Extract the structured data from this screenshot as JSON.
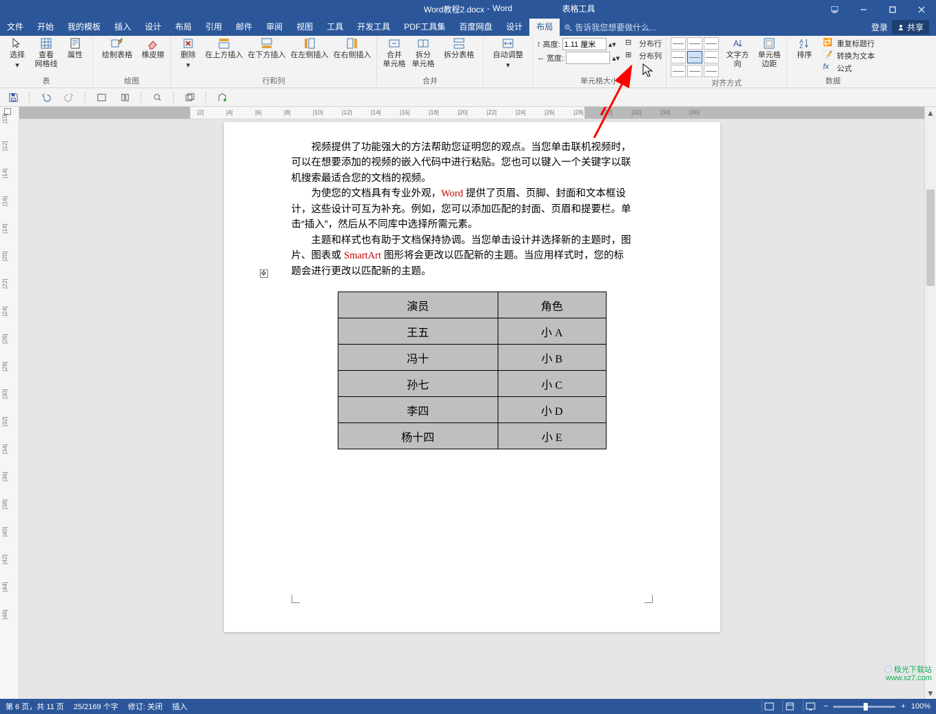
{
  "title": {
    "doc": "Word教程2.docx",
    "app": "Word",
    "tool_context": "表格工具"
  },
  "win": {
    "login": "登录",
    "share": "共享"
  },
  "tabs": [
    "文件",
    "开始",
    "我的模板",
    "插入",
    "设计",
    "布局",
    "引用",
    "邮件",
    "审阅",
    "视图",
    "工具",
    "开发工具",
    "PDF工具集",
    "百度网盘",
    "设计",
    "布局"
  ],
  "active_tab_index": 15,
  "tell_me": "告诉我您想要做什么...",
  "ribbon": {
    "g_table": {
      "select": "选择",
      "view_grid": "查看\n网格线",
      "props": "属性",
      "label": "表"
    },
    "g_draw": {
      "draw": "绘制表格",
      "erase": "橡皮擦",
      "label": "绘图"
    },
    "g_rc": {
      "delete": "删除",
      "ins_above": "在上方插入",
      "ins_below": "在下方插入",
      "ins_left": "在左侧插入",
      "ins_right": "在右侧插入",
      "label": "行和列"
    },
    "g_merge": {
      "merge": "合并\n单元格",
      "split": "拆分\n单元格",
      "split_tbl": "拆分表格",
      "label": "合并"
    },
    "g_auto": {
      "autofit": "自动调整",
      "label": ""
    },
    "g_size": {
      "height": "高度:",
      "width": "宽度:",
      "height_val": "1.11 厘米",
      "width_val": "",
      "dist_row": "分布行",
      "dist_col": "分布列",
      "label": "单元格大小"
    },
    "g_align": {
      "textdir": "文字方向",
      "margins": "单元格\n边距",
      "label": "对齐方式"
    },
    "g_data": {
      "sort": "排序",
      "repeat": "重复标题行",
      "convert": "转换为文本",
      "formula": "公式",
      "fx": "fx",
      "label": "数据"
    }
  },
  "ruler_h": [
    "|2|",
    "|4|",
    "|6|",
    "|8|",
    "|10|",
    "|12|",
    "|14|",
    "|16|",
    "|18|",
    "|20|",
    "|22|",
    "|24|",
    "|26|",
    "|28|",
    "|30|",
    "|32|",
    "|34|",
    "|36|"
  ],
  "ruler_v": [
    "|10|",
    "|12|",
    "|14|",
    "|16|",
    "|18|",
    "|20|",
    "|22|",
    "|24|",
    "|26|",
    "|28|",
    "|30|",
    "|32|",
    "|34|",
    "|36|",
    "|38|",
    "|40|",
    "|42|",
    "|44|",
    "|46|"
  ],
  "doc": {
    "p1a": "视频提供了功能强大的方法帮助您证明您的观点。当您单击联机视频时，",
    "p1b": "可以在想要添加的视频的嵌入代码中进行粘贴。您也可以键入一个关键字以联",
    "p1c": "机搜索最适合您的文档的视频。",
    "p2a": "为使您的文档具有专业外观，",
    "p2_hl": "Word",
    "p2b": " 提供了页眉、页脚、封面和文本框设",
    "p2c": "计，这些设计可互为补充。例如，您可以添加匹配的封面、页眉和提要栏。单",
    "p2d": "击“插入”，然后从不同库中选择所需元素。",
    "p3a": "主题和样式也有助于文档保持协调。当您单击设计并选择新的主题时，图",
    "p3b": "片、图表或 ",
    "p3_hl": "SmartArt",
    "p3c": " 图形将会更改以匹配新的主题。当应用样式时，您的标",
    "p3d": "题会进行更改以匹配新的主题。",
    "table": {
      "rows": [
        [
          "演员",
          "角色"
        ],
        [
          "王五",
          "小 A"
        ],
        [
          "冯十",
          "小 B"
        ],
        [
          "孙七",
          "小 C"
        ],
        [
          "李四",
          "小 D"
        ],
        [
          "杨十四",
          "小 E"
        ]
      ]
    }
  },
  "status": {
    "page": "第 6 页，共 11 页",
    "words": "25/2169 个字",
    "track": "修订: 关闭",
    "mode": "插入",
    "zoom": "100%"
  },
  "watermark": {
    "l1": "极光下载站",
    "l2": "www.xz7.com"
  }
}
